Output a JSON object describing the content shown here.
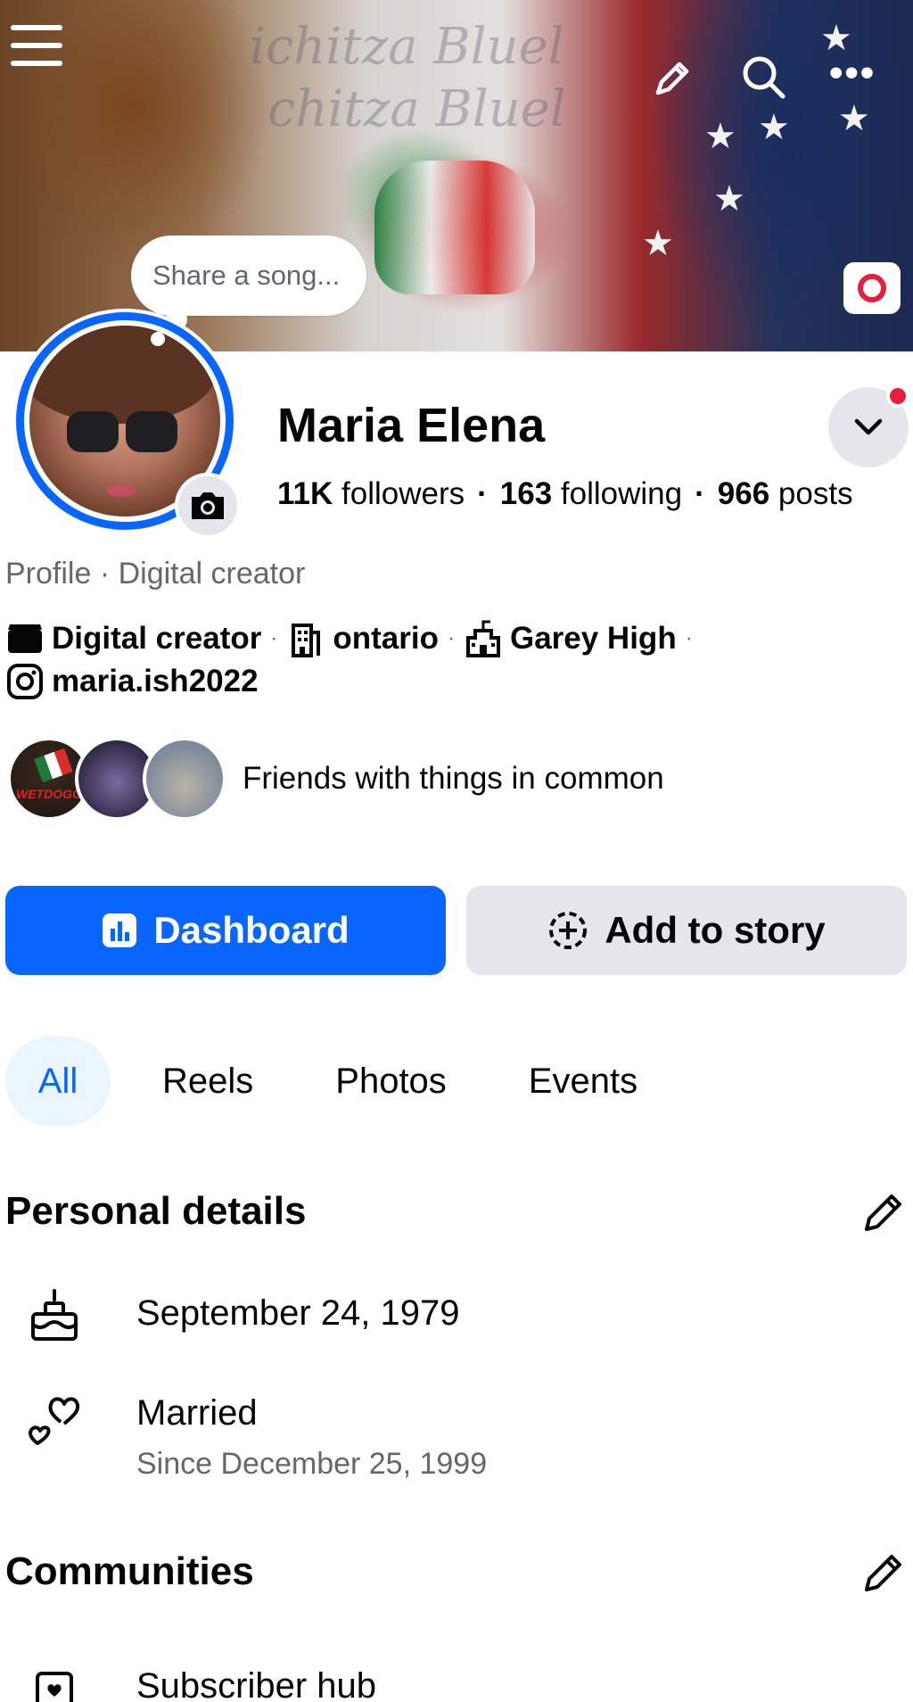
{
  "cover": {
    "song_prompt": "Share a song...",
    "icons": [
      "menu-icon",
      "edit-icon",
      "search-icon",
      "more-icon",
      "camera-icon"
    ]
  },
  "profile": {
    "name": "Maria Elena",
    "followers_count": "11K",
    "followers_label": "followers",
    "following_count": "163",
    "following_label": "following",
    "posts_count": "966",
    "posts_label": "posts",
    "subtitle": "Profile · Digital creator"
  },
  "info": {
    "category": "Digital creator",
    "location": "ontario",
    "school": "Garey High",
    "instagram": "maria.ish2022"
  },
  "friends": {
    "avatar_1_text": "WETDOGG",
    "text": "Friends with things in common"
  },
  "actions": {
    "dashboard_label": "Dashboard",
    "add_story_label": "Add to story"
  },
  "tabs": [
    {
      "label": "All",
      "active": true
    },
    {
      "label": "Reels",
      "active": false
    },
    {
      "label": "Photos",
      "active": false
    },
    {
      "label": "Events",
      "active": false
    }
  ],
  "personal_details": {
    "title": "Personal details",
    "birthday": "September 24, 1979",
    "relationship": "Married",
    "relationship_since": "Since December 25, 1999"
  },
  "communities": {
    "title": "Communities",
    "items": [
      {
        "label": "Subscriber hub"
      }
    ]
  },
  "colors": {
    "accent": "#0866ff",
    "notification": "#e41e3f",
    "secondary_text": "#65676b",
    "button_grey": "#e4e6eb"
  }
}
